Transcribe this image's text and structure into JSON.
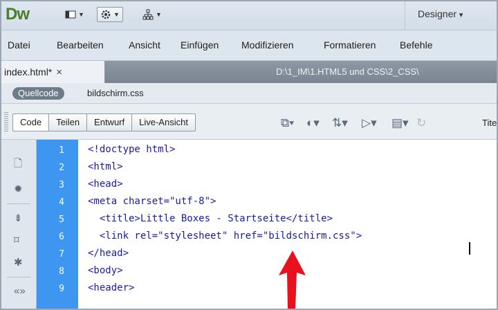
{
  "app": {
    "logo": "Dw",
    "workspace": "Designer",
    "workspace_arrow": "▾"
  },
  "toolbar_icons": [
    "layout-icon",
    "gear-icon",
    "site-icon"
  ],
  "menu": [
    "Datei",
    "Bearbeiten",
    "Ansicht",
    "Einfügen",
    "Modifizieren",
    "Formatieren",
    "Befehle"
  ],
  "document": {
    "tab_label": "index.html*",
    "close_glyph": "×",
    "path": "D:\\1_IM\\1.HTML5 und CSS\\2_CSS\\",
    "source_code_label": "Quellcode",
    "related_file": "bildschirm.css"
  },
  "views": [
    "Code",
    "Teilen",
    "Entwurf",
    "Live-Ansicht"
  ],
  "title_label": "Tite",
  "line_numbers": [
    "1",
    "2",
    "3",
    "4",
    "5",
    "6",
    "7",
    "8",
    "9"
  ],
  "code_lines": [
    "<!doctype html>",
    "<html>",
    "<head>",
    "<meta charset=\"utf-8\">",
    "  <title>Little Boxes - Startseite</title>",
    "  <link rel=\"stylesheet\" href=\"bildschirm.css\">",
    "</head>",
    "<body>",
    "<header>"
  ],
  "colors": {
    "gutter": "#3d96f0",
    "code_text": "#1a1aa6",
    "arrow": "#e8121f",
    "logo": "#4a7f2a"
  }
}
